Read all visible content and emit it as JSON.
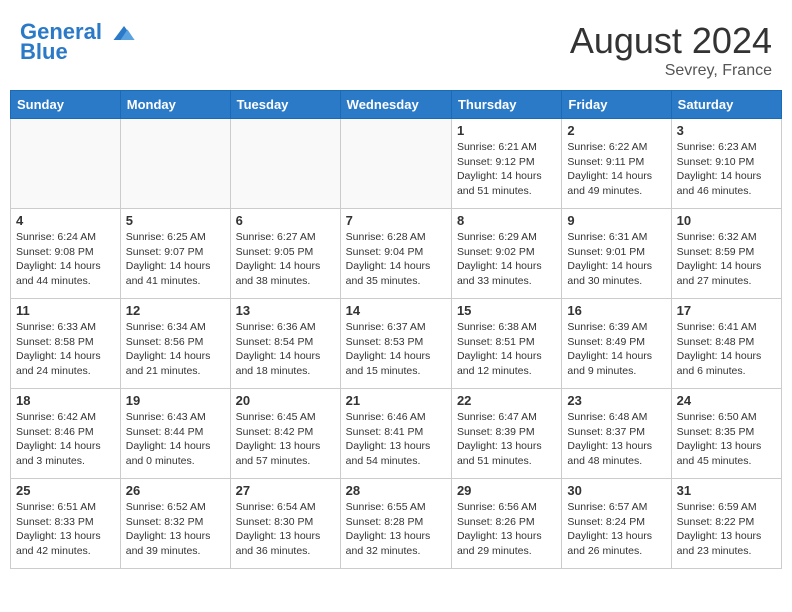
{
  "header": {
    "logo_line1": "General",
    "logo_line2": "Blue",
    "month_title": "August 2024",
    "location": "Sevrey, France"
  },
  "days_of_week": [
    "Sunday",
    "Monday",
    "Tuesday",
    "Wednesday",
    "Thursday",
    "Friday",
    "Saturday"
  ],
  "weeks": [
    [
      {
        "day": "",
        "info": ""
      },
      {
        "day": "",
        "info": ""
      },
      {
        "day": "",
        "info": ""
      },
      {
        "day": "",
        "info": ""
      },
      {
        "day": "1",
        "info": "Sunrise: 6:21 AM\nSunset: 9:12 PM\nDaylight: 14 hours and 51 minutes."
      },
      {
        "day": "2",
        "info": "Sunrise: 6:22 AM\nSunset: 9:11 PM\nDaylight: 14 hours and 49 minutes."
      },
      {
        "day": "3",
        "info": "Sunrise: 6:23 AM\nSunset: 9:10 PM\nDaylight: 14 hours and 46 minutes."
      }
    ],
    [
      {
        "day": "4",
        "info": "Sunrise: 6:24 AM\nSunset: 9:08 PM\nDaylight: 14 hours and 44 minutes."
      },
      {
        "day": "5",
        "info": "Sunrise: 6:25 AM\nSunset: 9:07 PM\nDaylight: 14 hours and 41 minutes."
      },
      {
        "day": "6",
        "info": "Sunrise: 6:27 AM\nSunset: 9:05 PM\nDaylight: 14 hours and 38 minutes."
      },
      {
        "day": "7",
        "info": "Sunrise: 6:28 AM\nSunset: 9:04 PM\nDaylight: 14 hours and 35 minutes."
      },
      {
        "day": "8",
        "info": "Sunrise: 6:29 AM\nSunset: 9:02 PM\nDaylight: 14 hours and 33 minutes."
      },
      {
        "day": "9",
        "info": "Sunrise: 6:31 AM\nSunset: 9:01 PM\nDaylight: 14 hours and 30 minutes."
      },
      {
        "day": "10",
        "info": "Sunrise: 6:32 AM\nSunset: 8:59 PM\nDaylight: 14 hours and 27 minutes."
      }
    ],
    [
      {
        "day": "11",
        "info": "Sunrise: 6:33 AM\nSunset: 8:58 PM\nDaylight: 14 hours and 24 minutes."
      },
      {
        "day": "12",
        "info": "Sunrise: 6:34 AM\nSunset: 8:56 PM\nDaylight: 14 hours and 21 minutes."
      },
      {
        "day": "13",
        "info": "Sunrise: 6:36 AM\nSunset: 8:54 PM\nDaylight: 14 hours and 18 minutes."
      },
      {
        "day": "14",
        "info": "Sunrise: 6:37 AM\nSunset: 8:53 PM\nDaylight: 14 hours and 15 minutes."
      },
      {
        "day": "15",
        "info": "Sunrise: 6:38 AM\nSunset: 8:51 PM\nDaylight: 14 hours and 12 minutes."
      },
      {
        "day": "16",
        "info": "Sunrise: 6:39 AM\nSunset: 8:49 PM\nDaylight: 14 hours and 9 minutes."
      },
      {
        "day": "17",
        "info": "Sunrise: 6:41 AM\nSunset: 8:48 PM\nDaylight: 14 hours and 6 minutes."
      }
    ],
    [
      {
        "day": "18",
        "info": "Sunrise: 6:42 AM\nSunset: 8:46 PM\nDaylight: 14 hours and 3 minutes."
      },
      {
        "day": "19",
        "info": "Sunrise: 6:43 AM\nSunset: 8:44 PM\nDaylight: 14 hours and 0 minutes."
      },
      {
        "day": "20",
        "info": "Sunrise: 6:45 AM\nSunset: 8:42 PM\nDaylight: 13 hours and 57 minutes."
      },
      {
        "day": "21",
        "info": "Sunrise: 6:46 AM\nSunset: 8:41 PM\nDaylight: 13 hours and 54 minutes."
      },
      {
        "day": "22",
        "info": "Sunrise: 6:47 AM\nSunset: 8:39 PM\nDaylight: 13 hours and 51 minutes."
      },
      {
        "day": "23",
        "info": "Sunrise: 6:48 AM\nSunset: 8:37 PM\nDaylight: 13 hours and 48 minutes."
      },
      {
        "day": "24",
        "info": "Sunrise: 6:50 AM\nSunset: 8:35 PM\nDaylight: 13 hours and 45 minutes."
      }
    ],
    [
      {
        "day": "25",
        "info": "Sunrise: 6:51 AM\nSunset: 8:33 PM\nDaylight: 13 hours and 42 minutes."
      },
      {
        "day": "26",
        "info": "Sunrise: 6:52 AM\nSunset: 8:32 PM\nDaylight: 13 hours and 39 minutes."
      },
      {
        "day": "27",
        "info": "Sunrise: 6:54 AM\nSunset: 8:30 PM\nDaylight: 13 hours and 36 minutes."
      },
      {
        "day": "28",
        "info": "Sunrise: 6:55 AM\nSunset: 8:28 PM\nDaylight: 13 hours and 32 minutes."
      },
      {
        "day": "29",
        "info": "Sunrise: 6:56 AM\nSunset: 8:26 PM\nDaylight: 13 hours and 29 minutes."
      },
      {
        "day": "30",
        "info": "Sunrise: 6:57 AM\nSunset: 8:24 PM\nDaylight: 13 hours and 26 minutes."
      },
      {
        "day": "31",
        "info": "Sunrise: 6:59 AM\nSunset: 8:22 PM\nDaylight: 13 hours and 23 minutes."
      }
    ]
  ]
}
